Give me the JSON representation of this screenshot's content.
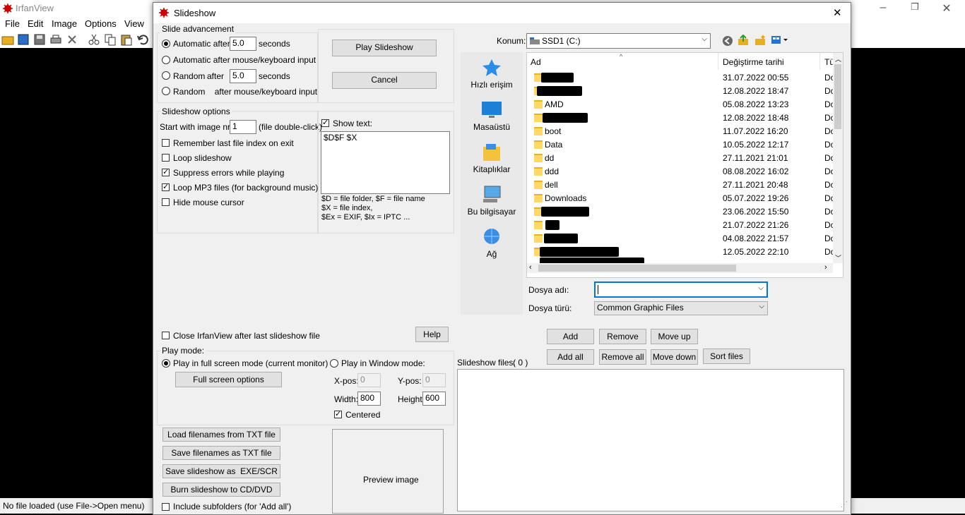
{
  "app": {
    "title": "IrfanView",
    "menu": [
      "File",
      "Edit",
      "Image",
      "Options",
      "View"
    ],
    "window_controls": [
      "minimize",
      "restore",
      "close"
    ],
    "status": "No file loaded (use File->Open menu)"
  },
  "dialog": {
    "title": "Slideshow",
    "close_glyph": "✕",
    "slide_advancement": {
      "title": "Slide advancement",
      "auto_label": "Automatic after",
      "auto_value": "5.0",
      "seconds1": "seconds",
      "auto_mouse_label": "Automatic after mouse/keyboard input",
      "random_label": "Random",
      "random_after": "after",
      "random_value": "5.0",
      "seconds2": "seconds",
      "random_mouse_label": "Random    after mouse/keyboard input"
    },
    "play_button": "Play Slideshow",
    "cancel_button": "Cancel",
    "slideshow_options": {
      "title": "Slideshow options",
      "start_label": "Start with image nr.:",
      "start_value": "1",
      "start_hint": "(file double-click)",
      "remember": "Remember last file index on exit",
      "loop": "Loop slideshow",
      "suppress": "Suppress errors while playing",
      "loop_mp3": "Loop MP3 files (for background music)",
      "hide_cursor": "Hide mouse cursor",
      "show_text_label": "Show text:",
      "show_text_value": "$D$F $X",
      "help_line1": "$D = file folder, $F = file name",
      "help_line2": "$X = file index,",
      "help_line3": "$Ex = EXIF, $Ix = IPTC ..."
    },
    "close_after": "Close IrfanView after last slideshow file",
    "help_button": "Help",
    "play_mode": {
      "title": "Play mode:",
      "fullscreen_label": "Play in full screen mode (current monitor)",
      "fullscreen_options": "Full screen options",
      "window_label": "Play in Window mode:",
      "xpos_label": "X-pos:",
      "xpos_value": "0",
      "ypos_label": "Y-pos:",
      "ypos_value": "0",
      "width_label": "Width:",
      "width_value": "800",
      "height_label": "Height:",
      "height_value": "600",
      "centered": "Centered"
    },
    "buttons_bottom": {
      "load_txt": "Load filenames from TXT file",
      "save_txt": "Save filenames as TXT file",
      "save_exe": "Save slideshow as  EXE/SCR",
      "burn": "Burn slideshow to CD/DVD",
      "include_sub": "Include subfolders (for 'Add all')"
    },
    "preview": "Preview image",
    "browser": {
      "location_label": "Konum:",
      "location_value": "SSD1 (C:)",
      "places": [
        "Hızlı erişim",
        "Masaüstü",
        "Kitaplıklar",
        "Bu bilgisayar",
        "Ağ"
      ],
      "columns": [
        "Ad",
        "Değiştirme tarihi",
        "Tü"
      ],
      "rows": [
        {
          "name": "",
          "date": "31.07.2022 00:55",
          "type": "Do"
        },
        {
          "name": "",
          "date": "12.08.2022 18:47",
          "type": "Do"
        },
        {
          "name": "AMD",
          "date": "05.08.2022 13:23",
          "type": "Do"
        },
        {
          "name": "",
          "date": "12.08.2022 18:48",
          "type": "Do"
        },
        {
          "name": "boot",
          "date": "11.07.2022 16:20",
          "type": "Do"
        },
        {
          "name": "Data",
          "date": "10.05.2022 12:17",
          "type": "Do"
        },
        {
          "name": "dd",
          "date": "27.11.2021 21:01",
          "type": "Do"
        },
        {
          "name": "ddd",
          "date": "08.08.2022 16:02",
          "type": "Do"
        },
        {
          "name": "dell",
          "date": "27.11.2021 20:48",
          "type": "Do"
        },
        {
          "name": "Downloads",
          "date": "05.07.2022 19:26",
          "type": "Do"
        },
        {
          "name": "",
          "date": "23.06.2022 15:50",
          "type": "Do"
        },
        {
          "name": "",
          "date": "21.07.2022 21:26",
          "type": "Do"
        },
        {
          "name": "",
          "date": "04.08.2022 21:57",
          "type": "Do"
        },
        {
          "name": "",
          "date": "12.05.2022 22:10",
          "type": "Do"
        }
      ],
      "filename_label": "Dosya adı:",
      "filename_value": "",
      "filetype_label": "Dosya türü:",
      "filetype_value": "Common Graphic Files"
    },
    "list_buttons": {
      "add": "Add",
      "remove": "Remove",
      "move_up": "Move up",
      "add_all": "Add all",
      "remove_all": "Remove all",
      "move_down": "Move down",
      "sort": "Sort files"
    },
    "slideshow_files_label": "Slideshow files:",
    "slideshow_files_count": "( 0 )"
  }
}
